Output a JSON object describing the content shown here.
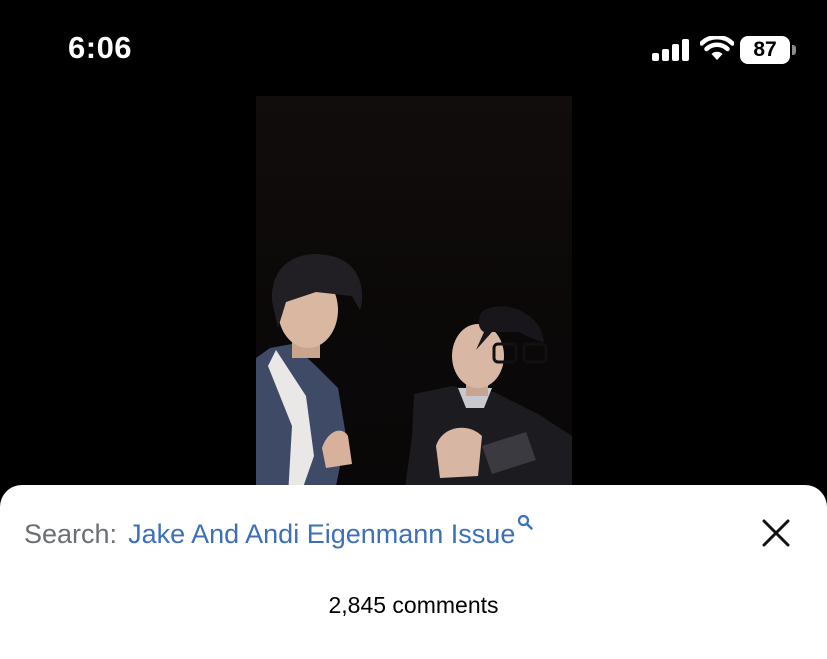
{
  "status_bar": {
    "time": "6:06",
    "battery_level": "87",
    "icons": [
      "signal-icon",
      "wifi-icon",
      "battery-icon"
    ]
  },
  "video": {
    "description_icon": "video-frame"
  },
  "sheet": {
    "search_label": "Search:",
    "search_query": "Jake And Andi Eigenmann Issue",
    "search_icon": "search-icon",
    "close_icon": "close-icon",
    "comment_count": "2,845 comments"
  },
  "colors": {
    "search_link": "#3d6fbb",
    "search_label": "#6b6e73",
    "sheet_background": "#ffffff",
    "page_background": "#000000"
  }
}
